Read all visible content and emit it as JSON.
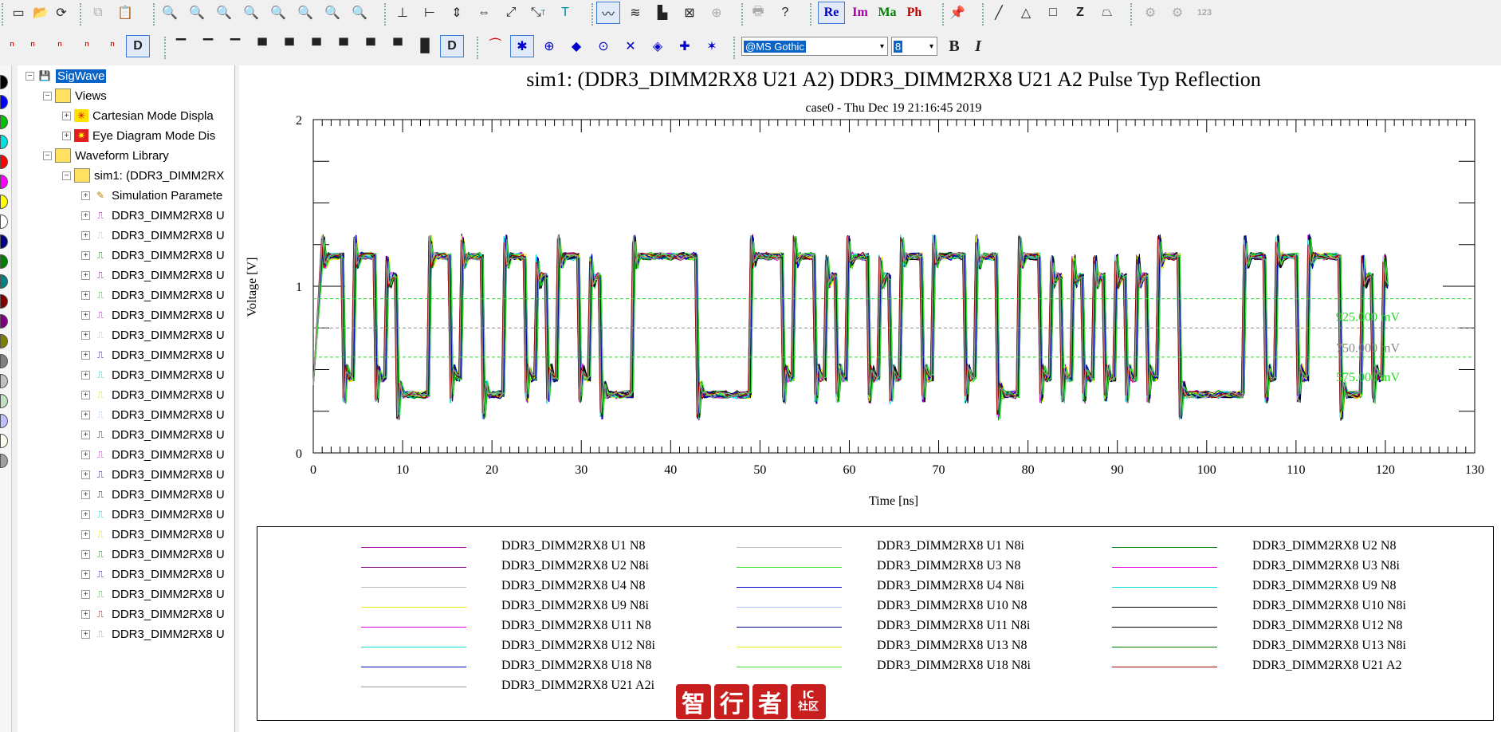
{
  "toolbar1": {
    "trace_buttons": {
      "re_label": "Re",
      "im_label": "Im",
      "ma_label": "Ma",
      "ph_label": "Ph"
    },
    "label_123": "123",
    "text_button": "T",
    "text_button_sup": "T"
  },
  "toolbar2": {
    "font_name": "@MS Gothic",
    "font_size": "8",
    "bold_label": "B",
    "italic_label": "I",
    "toggle_d1": "D",
    "toggle_d2": "D"
  },
  "palette_colors": [
    "#000000",
    "#0000ff",
    "#00c000",
    "#00e0e0",
    "#ff0000",
    "#ff00ff",
    "#ffff00",
    "#ffffff",
    "#000080",
    "#008000",
    "#008080",
    "#800000",
    "#800080",
    "#808000",
    "#808080",
    "#c0c0c0",
    "#c0e0c0",
    "#c0c0ff",
    "#fffff0",
    "#a0a0a0"
  ],
  "tree": {
    "root": "SigWave",
    "views": "Views",
    "cartesian": "Cartesian Mode Displa",
    "eye": "Eye Diagram Mode Dis",
    "library": "Waveform Library",
    "sim": "sim1: (DDR3_DIMM2RX",
    "sim_params": "Simulation Paramete",
    "waveforms": [
      {
        "label": "DDR3_DIMM2RX8 U",
        "color": "#c000c0"
      },
      {
        "label": "DDR3_DIMM2RX8 U",
        "color": "#bbbbbb"
      },
      {
        "label": "DDR3_DIMM2RX8 U",
        "color": "#008000"
      },
      {
        "label": "DDR3_DIMM2RX8 U",
        "color": "#800080"
      },
      {
        "label": "DDR3_DIMM2RX8 U",
        "color": "#20c020"
      },
      {
        "label": "DDR3_DIMM2RX8 U",
        "color": "#e000e0"
      },
      {
        "label": "DDR3_DIMM2RX8 U",
        "color": "#bbbbbb"
      },
      {
        "label": "DDR3_DIMM2RX8 U",
        "color": "#0000c0"
      },
      {
        "label": "DDR3_DIMM2RX8 U",
        "color": "#00d0d0"
      },
      {
        "label": "DDR3_DIMM2RX8 U",
        "color": "#e0e000"
      },
      {
        "label": "DDR3_DIMM2RX8 U",
        "color": "#a0c8ff"
      },
      {
        "label": "DDR3_DIMM2RX8 U",
        "color": "#000000"
      },
      {
        "label": "DDR3_DIMM2RX8 U",
        "color": "#e000e0"
      },
      {
        "label": "DDR3_DIMM2RX8 U",
        "color": "#000080"
      },
      {
        "label": "DDR3_DIMM2RX8 U",
        "color": "#000000"
      },
      {
        "label": "DDR3_DIMM2RX8 U",
        "color": "#00d0d0"
      },
      {
        "label": "DDR3_DIMM2RX8 U",
        "color": "#e0e000"
      },
      {
        "label": "DDR3_DIMM2RX8 U",
        "color": "#008000"
      },
      {
        "label": "DDR3_DIMM2RX8 U",
        "color": "#0000c0"
      },
      {
        "label": "DDR3_DIMM2RX8 U",
        "color": "#20c020"
      },
      {
        "label": "DDR3_DIMM2RX8 U",
        "color": "#a00000"
      },
      {
        "label": "DDR3_DIMM2RX8 U",
        "color": "#999999"
      }
    ]
  },
  "chart_data": {
    "type": "line",
    "title": "sim1: (DDR3_DIMM2RX8 U21 A2) DDR3_DIMM2RX8 U21 A2 Pulse Typ Reflection",
    "subtitle": "case0 - Thu Dec 19 21:16:45 2019",
    "xlabel": "Time [ns]",
    "ylabel": "Voltage [V]",
    "xlim": [
      0,
      130
    ],
    "ylim": [
      0,
      2
    ],
    "x_ticks": [
      0,
      10,
      20,
      30,
      40,
      50,
      60,
      70,
      80,
      90,
      100,
      110,
      120,
      130
    ],
    "y_ticks": [
      0,
      1,
      2
    ],
    "signal_end_ns": 120,
    "high_level_v": 1.18,
    "low_level_v": 0.35,
    "thresholds": [
      {
        "value_v": 0.925,
        "label": "925.000 mV",
        "color": "#22dd22"
      },
      {
        "value_v": 0.75,
        "label": "750.000 mV",
        "color": "#888888"
      },
      {
        "value_v": 0.575,
        "label": "575.000 mV",
        "color": "#22dd22"
      }
    ],
    "bit_pattern": "1101101000110110011010110100011111100000111011010110101101110110011010101010101100000011011011100101",
    "unit_interval_ns": 1.2,
    "series": [
      {
        "name": "DDR3_DIMM2RX8 U1 N8",
        "color": "#a000a0"
      },
      {
        "name": "DDR3_DIMM2RX8 U1 N8i",
        "color": "#bbbbbb"
      },
      {
        "name": "DDR3_DIMM2RX8 U2 N8",
        "color": "#008000"
      },
      {
        "name": "DDR3_DIMM2RX8 U2 N8i",
        "color": "#800080"
      },
      {
        "name": "DDR3_DIMM2RX8 U3 N8",
        "color": "#33dd33"
      },
      {
        "name": "DDR3_DIMM2RX8 U3 N8i",
        "color": "#e000e0"
      },
      {
        "name": "DDR3_DIMM2RX8 U4 N8",
        "color": "#bbbbbb"
      },
      {
        "name": "DDR3_DIMM2RX8 U4 N8i",
        "color": "#0000c0"
      },
      {
        "name": "DDR3_DIMM2RX8 U9 N8",
        "color": "#00dddd"
      },
      {
        "name": "DDR3_DIMM2RX8 U9 N8i",
        "color": "#eeee00"
      },
      {
        "name": "DDR3_DIMM2RX8 U10 N8",
        "color": "#a8c8ff"
      },
      {
        "name": "DDR3_DIMM2RX8 U10 N8i",
        "color": "#000000"
      },
      {
        "name": "DDR3_DIMM2RX8 U11 N8",
        "color": "#e000e0"
      },
      {
        "name": "DDR3_DIMM2RX8 U11 N8i",
        "color": "#000080"
      },
      {
        "name": "DDR3_DIMM2RX8 U12 N8",
        "color": "#000000"
      },
      {
        "name": "DDR3_DIMM2RX8 U12 N8i",
        "color": "#00dddd"
      },
      {
        "name": "DDR3_DIMM2RX8 U13 N8",
        "color": "#eeee00"
      },
      {
        "name": "DDR3_DIMM2RX8 U13 N8i",
        "color": "#008000"
      },
      {
        "name": "DDR3_DIMM2RX8 U18 N8",
        "color": "#0000c0"
      },
      {
        "name": "DDR3_DIMM2RX8 U18 N8i",
        "color": "#33dd33"
      },
      {
        "name": "DDR3_DIMM2RX8 U21 A2",
        "color": "#a00000"
      },
      {
        "name": "DDR3_DIMM2RX8 U21 A2i",
        "color": "#999999"
      }
    ]
  },
  "watermark": {
    "chars": [
      "智",
      "行",
      "者"
    ],
    "badge": "IC\n社区"
  }
}
